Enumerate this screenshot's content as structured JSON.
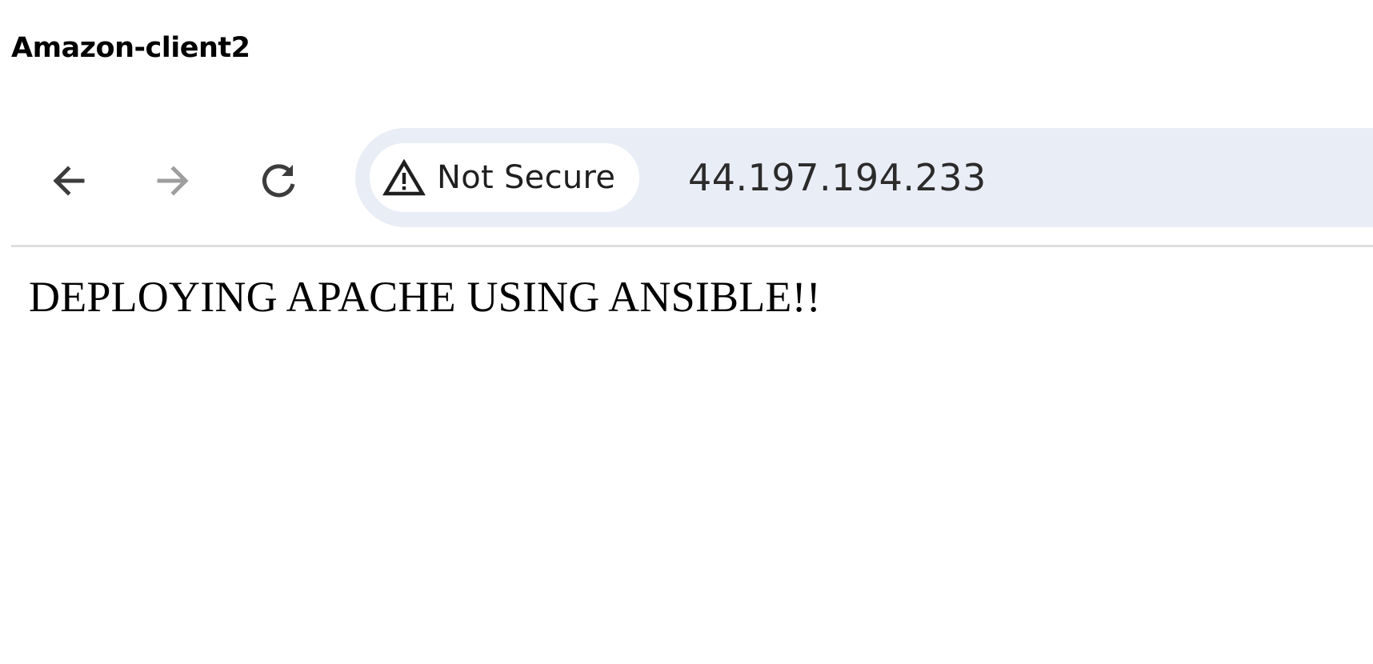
{
  "caption": "Amazon-client2",
  "browser": {
    "nav": {
      "back_icon": "arrow-left-icon",
      "forward_icon": "arrow-right-icon",
      "reload_icon": "reload-icon"
    },
    "address_bar": {
      "security_icon": "warning-triangle-icon",
      "security_label": "Not Secure",
      "url": "44.197.194.233"
    }
  },
  "page": {
    "heading": "DEPLOYING APACHE USING ANSIBLE!!"
  },
  "colors": {
    "omnibox_bg": "#e9edf6",
    "forward_disabled": "#9e9e9e",
    "icon_active": "#3c3c3c"
  }
}
